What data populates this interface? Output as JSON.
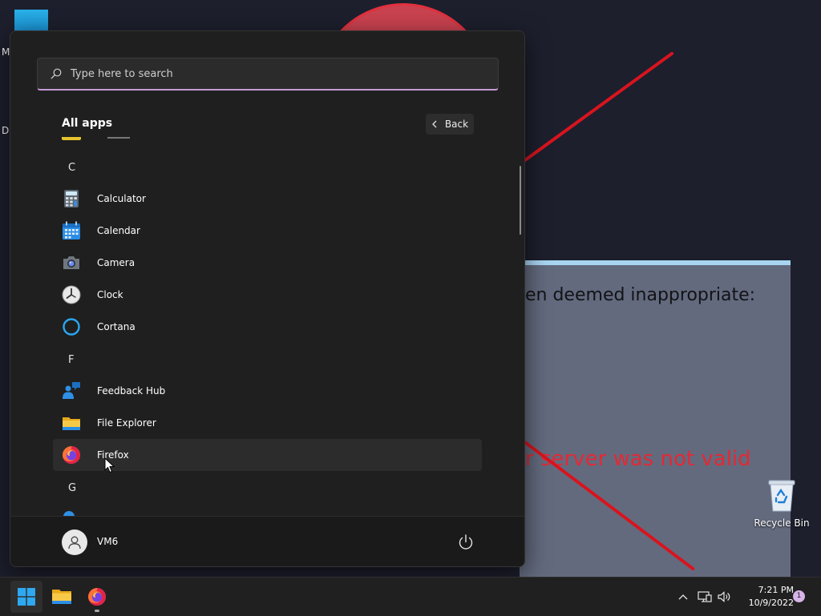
{
  "desktop": {
    "fragments": [
      "M",
      "Da"
    ],
    "background_window": {
      "line1": "en deemed inappropriate:",
      "line2": "r server was not valid"
    },
    "recycle_bin_label": "Recycle Bin"
  },
  "start_menu": {
    "search_placeholder": "Type here to search",
    "all_apps_title": "All apps",
    "back_label": "Back",
    "sections": [
      {
        "letter": "C",
        "apps": [
          {
            "label": "Calculator",
            "icon": "calculator-icon"
          },
          {
            "label": "Calendar",
            "icon": "calendar-icon"
          },
          {
            "label": "Camera",
            "icon": "camera-icon"
          },
          {
            "label": "Clock",
            "icon": "clock-icon"
          },
          {
            "label": "Cortana",
            "icon": "cortana-icon"
          }
        ]
      },
      {
        "letter": "F",
        "apps": [
          {
            "label": "Feedback Hub",
            "icon": "feedback-hub-icon"
          },
          {
            "label": "File Explorer",
            "icon": "file-explorer-icon"
          },
          {
            "label": "Firefox",
            "icon": "firefox-icon",
            "hovered": true
          }
        ]
      },
      {
        "letter": "G",
        "apps": []
      }
    ],
    "user_name": "VM6"
  },
  "taskbar": {
    "time": "7:21 PM",
    "date": "10/9/2022",
    "notification_count": "1"
  },
  "colors": {
    "accent": "#c69bd6",
    "menu_bg": "#1f1f1f",
    "taskbar_bg": "#202020",
    "wallpaper_red": "#d8141e"
  }
}
